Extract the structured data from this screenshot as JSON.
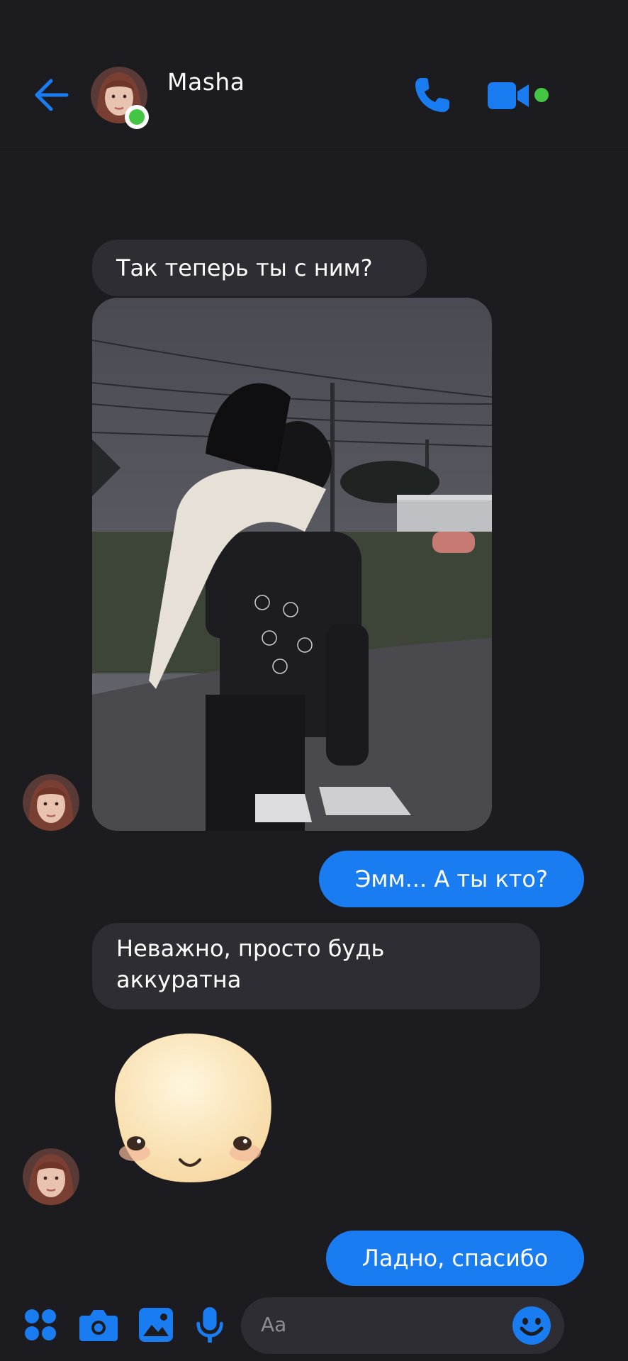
{
  "header": {
    "contact_name": "Masha",
    "online": true
  },
  "messages": [
    {
      "direction": "in",
      "text": "Так теперь ты с ним?"
    },
    {
      "direction": "in",
      "type": "photo"
    },
    {
      "direction": "out",
      "text": "Эмм... А ты кто?"
    },
    {
      "direction": "in",
      "text": "Неважно, просто будь аккуратна"
    },
    {
      "direction": "in",
      "type": "sticker"
    },
    {
      "direction": "out",
      "text": "Ладно, спасибо"
    }
  ],
  "composer": {
    "placeholder": "Aa"
  },
  "colors": {
    "accent": "#1a7cf1",
    "online": "#44c544",
    "bubble_in": "#2e2d33",
    "background": "#1c1b1f"
  },
  "icons": [
    "back-arrow-icon",
    "phone-icon",
    "video-camera-icon",
    "apps-icon",
    "camera-icon",
    "gallery-icon",
    "microphone-icon",
    "emoji-icon"
  ]
}
